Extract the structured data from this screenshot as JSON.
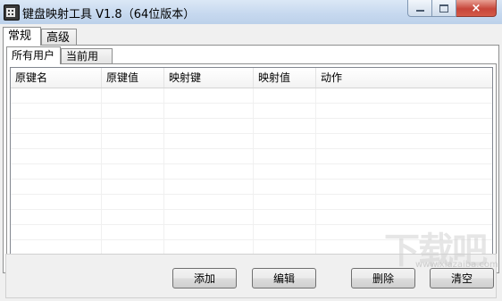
{
  "window": {
    "title": "键盘映射工具 V1.8（64位版本）",
    "icon": "keyboard-grid-icon"
  },
  "caption_buttons": {
    "minimize": "minimize-icon",
    "maximize": "maximize-icon",
    "close": "close-icon",
    "close_glyph": "×"
  },
  "outer_tabs": [
    {
      "label": "常规",
      "active": true
    },
    {
      "label": "高级",
      "active": false
    }
  ],
  "inner_tabs": [
    {
      "label": "所有用户",
      "active": true
    },
    {
      "label": "当前用户",
      "active": false
    }
  ],
  "table": {
    "columns": [
      "原键名",
      "原键值",
      "映射键",
      "映射值",
      "动作"
    ],
    "rows": []
  },
  "buttons": {
    "add": "添加",
    "edit": "编辑",
    "delete": "删除",
    "clear": "清空"
  },
  "watermark": {
    "logo": "下载吧",
    "url": "www.xiazaiba.com"
  }
}
